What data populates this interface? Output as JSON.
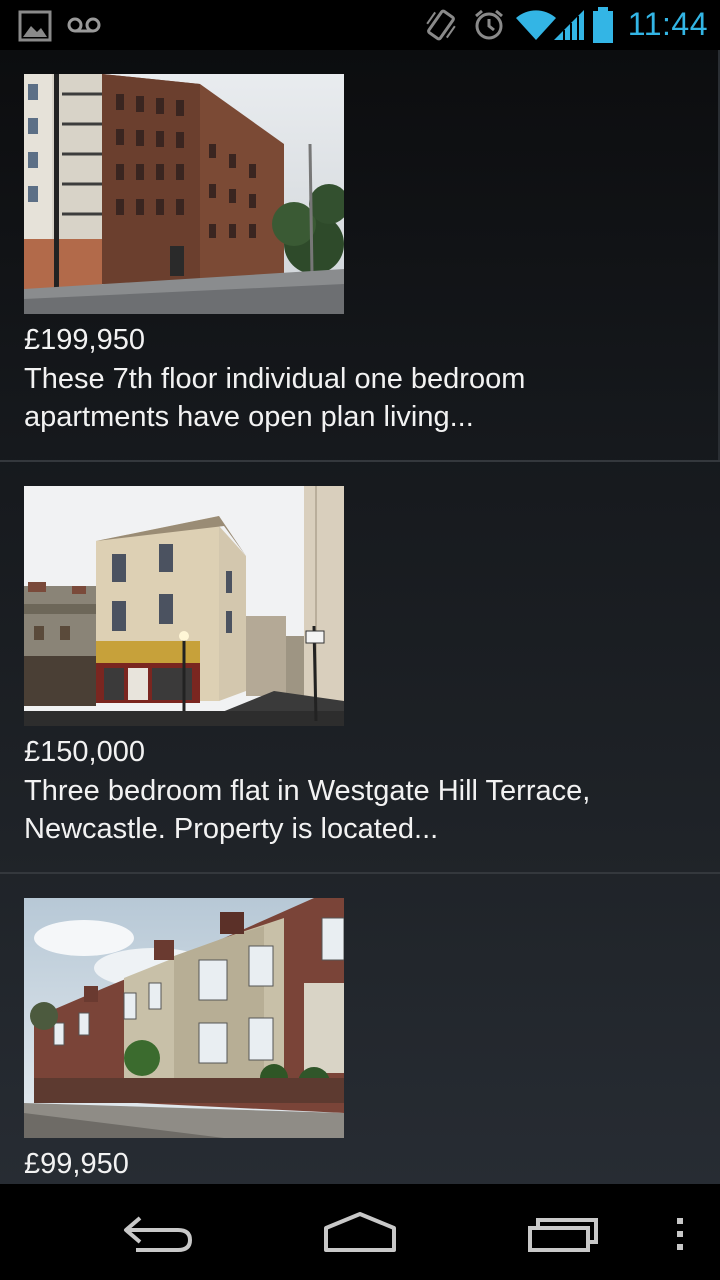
{
  "status_bar": {
    "time": "11:44",
    "icons": [
      "image-icon",
      "voicemail-icon",
      "vibrate-icon",
      "alarm-icon",
      "wifi-icon",
      "signal-icon",
      "battery-icon"
    ]
  },
  "listings": [
    {
      "price": "£199,950",
      "description_line1": "These 7th floor individual one bedroom",
      "description_line2": "apartments have open plan living..."
    },
    {
      "price": "£150,000",
      "description_line1": "Three bedroom flat in Westgate Hill Terrace,",
      "description_line2": "Newcastle. Property is located..."
    },
    {
      "price": "£99,950"
    }
  ],
  "nav_bar": {
    "buttons": [
      "back-icon",
      "home-icon",
      "recent-apps-icon",
      "overflow-menu-icon"
    ]
  }
}
